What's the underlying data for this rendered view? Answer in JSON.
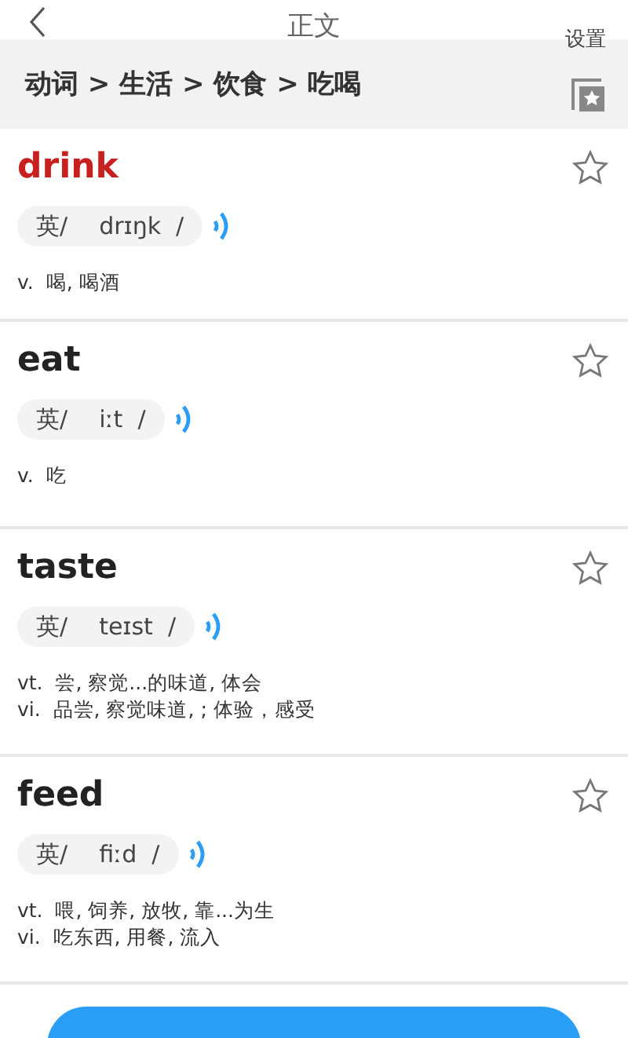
{
  "header": {
    "title": "正文",
    "settings": "设置"
  },
  "breadcrumb": "动词 > 生活 > 饮食 > 吃喝",
  "words": [
    {
      "word": "drink",
      "highlighted": true,
      "starred": false,
      "accent": "英/",
      "phonetic": "drɪŋk  /",
      "senses": [
        {
          "pos": "v.",
          "meaning": "喝, 喝酒"
        }
      ]
    },
    {
      "word": "eat",
      "highlighted": false,
      "starred": false,
      "accent": "英/",
      "phonetic": "iːt  /",
      "senses": [
        {
          "pos": "v.",
          "meaning": "吃"
        }
      ]
    },
    {
      "word": "taste",
      "highlighted": false,
      "starred": false,
      "accent": "英/",
      "phonetic": "teɪst  /",
      "senses": [
        {
          "pos": "vt.",
          "meaning": "尝, 察觉...的味道, 体会"
        },
        {
          "pos": "vi.",
          "meaning": "品尝, 察觉味道, ; 体验，感受"
        }
      ]
    },
    {
      "word": "feed",
      "highlighted": false,
      "starred": false,
      "accent": "英/",
      "phonetic": "fiːd  /",
      "senses": [
        {
          "pos": "vt.",
          "meaning": "喂, 饲养, 放牧, 靠...为生"
        },
        {
          "pos": "vi.",
          "meaning": "吃东西, 用餐, 流入"
        }
      ]
    }
  ]
}
